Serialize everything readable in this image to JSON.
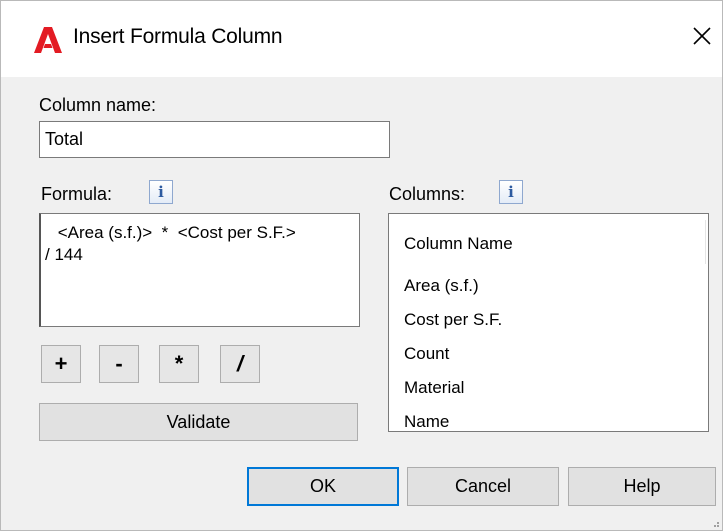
{
  "window": {
    "title": "Insert Formula Column",
    "icon": "autocad-logo-icon",
    "accent_color": "#e31b23"
  },
  "column_name": {
    "label": "Column name:",
    "value": "Total"
  },
  "formula": {
    "label": "Formula:",
    "info_icon": "info-icon",
    "line1": " <Area (s.f.)>  *  <Cost per S.F.>",
    "line2": "/ 144"
  },
  "operators": [
    "+",
    "-",
    "*",
    "/"
  ],
  "validate_label": "Validate",
  "columns": {
    "label": "Columns:",
    "info_icon": "info-icon",
    "header": "Column Name",
    "items": [
      "Area (s.f.)",
      "Cost per S.F.",
      "Count",
      "Material",
      "Name"
    ]
  },
  "footer": {
    "ok_label": "OK",
    "cancel_label": "Cancel",
    "help_label": "Help"
  }
}
